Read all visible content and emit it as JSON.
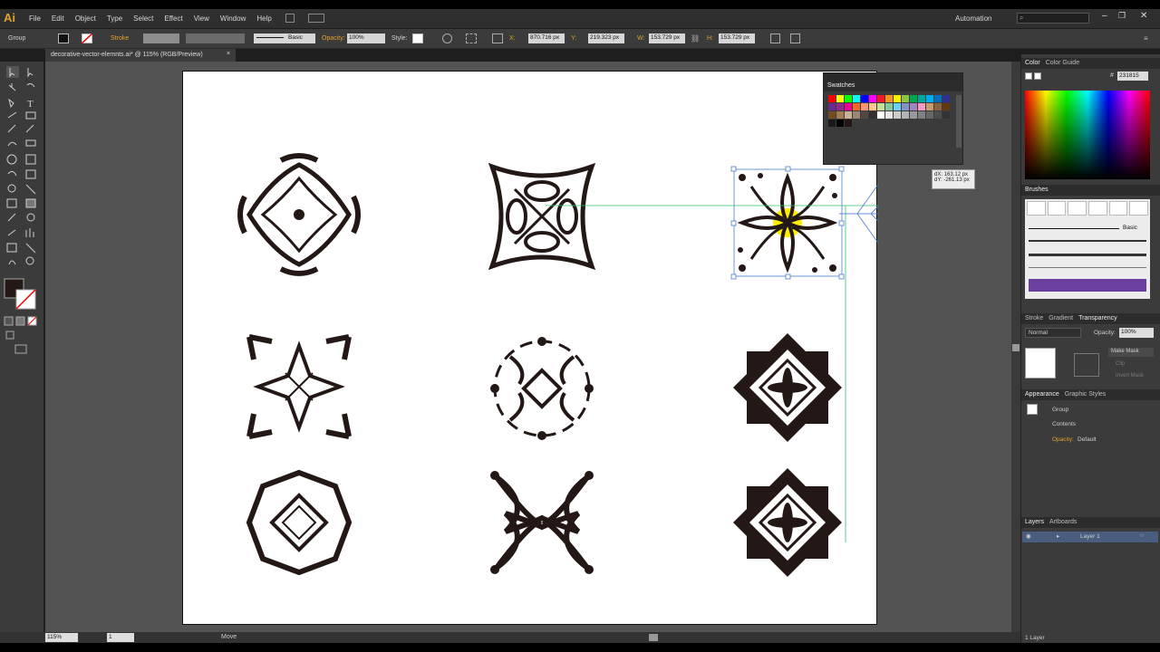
{
  "menubar": {
    "logo": "Ai",
    "items": [
      "File",
      "Edit",
      "Object",
      "Type",
      "Select",
      "Effect",
      "View",
      "Window",
      "Help"
    ],
    "workspace": "Automation",
    "window_controls": [
      "–",
      "❐",
      "✕"
    ]
  },
  "control_bar": {
    "selection_label": "Group",
    "stroke_label": "Stroke",
    "brush_label": "Basic",
    "opacity_label": "Opacity:",
    "opacity_value": "100%",
    "style_label": "Style:",
    "x_label": "X:",
    "x_value": "870.716 px",
    "y_label": "Y:",
    "y_value": "219.323 px",
    "w_label": "W:",
    "w_value": "153.729 px",
    "h_label": "H:",
    "h_value": "153.729 px"
  },
  "document_tab": {
    "title": "decorative-vector-elemnts.ai* @ 115% (RGB/Preview)",
    "close": "×"
  },
  "tooltip": {
    "dx": "dX: 163.12 px",
    "dy": "dY: -261.13 px"
  },
  "swatches_panel": {
    "title": "Swatches",
    "colors": [
      "#ff0000",
      "#ffff00",
      "#00ff00",
      "#00ffff",
      "#0000ff",
      "#ff00ff",
      "#ed1c24",
      "#f7941d",
      "#fff200",
      "#8dc63f",
      "#00a651",
      "#00a99d",
      "#00aeef",
      "#0072bc",
      "#2e3192",
      "#662d91",
      "#92278f",
      "#ec008c",
      "#f26522",
      "#f7977a",
      "#fdc689",
      "#c4df9b",
      "#82ca9c",
      "#6dcff6",
      "#8393ca",
      "#a186be",
      "#f49ac2",
      "#c69c6d",
      "#8c6239",
      "#603913",
      "#754c24",
      "#a67c52",
      "#c7b299",
      "#998675",
      "#534741",
      "#362f2d",
      "#ffffff",
      "#e6e6e6",
      "#cccccc",
      "#b3b3b3",
      "#999999",
      "#808080",
      "#666666",
      "#4d4d4d",
      "#333333",
      "#1a1a1a",
      "#000000",
      "#231815"
    ]
  },
  "status": {
    "zoom": "115%",
    "artboard": "1",
    "tool": "Move"
  },
  "color_panel": {
    "tabs": [
      "Color",
      "Color Guide"
    ],
    "hex": "231815"
  },
  "brushes_panel": {
    "title": "Brushes",
    "basic": "Basic"
  },
  "transparency_panel": {
    "tabs": [
      "Stroke",
      "Gradient",
      "Transparency"
    ],
    "mode": "Normal",
    "opacity_label": "Opacity:",
    "opacity_value": "100%",
    "make_mask": "Make Mask",
    "clip": "Clip",
    "invert_mask": "Invert Mask"
  },
  "appearance_panel": {
    "tabs": [
      "Appearance",
      "Graphic Styles"
    ],
    "group": "Group",
    "contents": "Contents",
    "opacity": "Opacity:",
    "opacity_value": "Default"
  },
  "layers_panel": {
    "tabs": [
      "Layers",
      "Artboards"
    ],
    "layer_name": "Layer 1",
    "count": "1 Layer"
  },
  "accent": {
    "selection_blue": "#4a7bd1",
    "smart_guide_green": "#36c26e",
    "highlight_yellow": "#ffee00",
    "ai_orange": "#e0a22a"
  }
}
